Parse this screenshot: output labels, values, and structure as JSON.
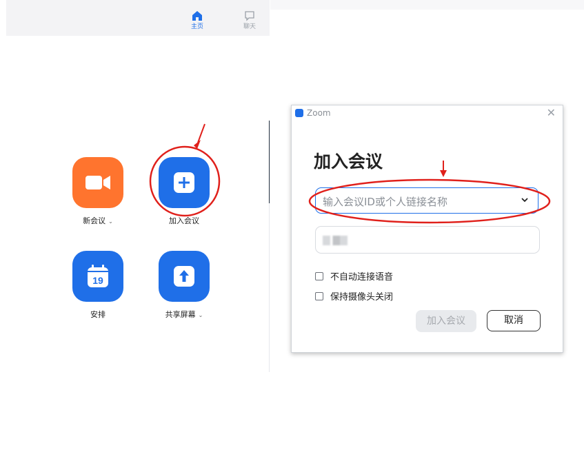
{
  "left_nav": {
    "tabs": [
      {
        "label": "主页",
        "icon": "home-icon",
        "active": true
      },
      {
        "label": "聊天",
        "icon": "chat-icon",
        "active": false
      }
    ]
  },
  "apps": {
    "new_meeting": {
      "label": "新会议",
      "icon": "video-camera-icon",
      "color": "#ff742e"
    },
    "join_meeting": {
      "label": "加入会议",
      "icon": "plus-icon",
      "color": "#1f6fe8"
    },
    "schedule": {
      "label": "安排",
      "icon": "calendar-icon",
      "day": "19",
      "color": "#1f6fe8"
    },
    "share_screen": {
      "label": "共享屏幕",
      "icon": "share-up-arrow-icon",
      "color": "#1f6fe8"
    }
  },
  "dialog": {
    "title": "Zoom",
    "heading": "加入会议",
    "meeting_id_placeholder": "输入会议ID或个人链接名称",
    "options": [
      {
        "label": "不自动连接语音",
        "checked": false
      },
      {
        "label": "保持摄像头关闭",
        "checked": false
      }
    ],
    "join_button": "加入会议",
    "cancel_button": "取消"
  },
  "annotation_color": "#e0201b"
}
